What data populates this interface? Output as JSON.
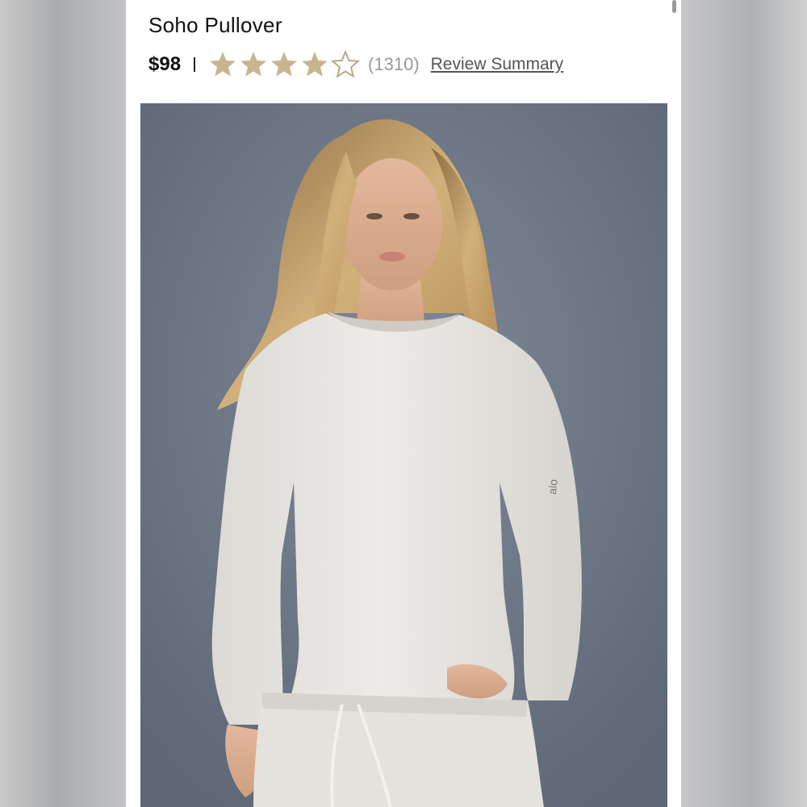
{
  "product": {
    "title": "Soho Pullover",
    "price": "$98",
    "rating": {
      "value": 4,
      "max": 5,
      "count": "(1310)",
      "filled_color": "#c8b48e",
      "empty_color": "#b9a684"
    },
    "review_summary_label": "Review Summary",
    "image": {
      "alt": "woman-in-white-pullover",
      "logo_text": "alo"
    }
  },
  "colors": {
    "photo_background": "#6c7685",
    "garment": "#e8e6e1",
    "hair": "#c9a46a"
  }
}
